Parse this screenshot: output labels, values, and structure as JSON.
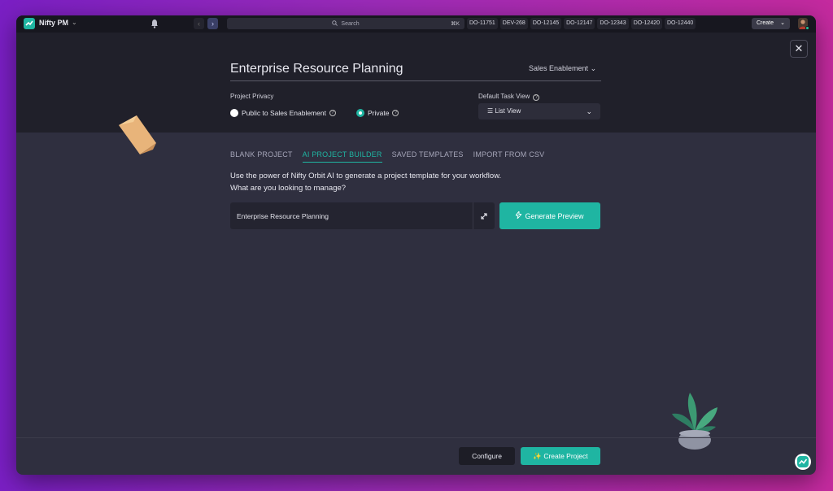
{
  "topbar": {
    "workspace_name": "Nifty PM",
    "search_placeholder": "Search",
    "search_shortcut": "⌘K",
    "tickets": [
      "DO-11751",
      "DEV-268",
      "DO-12145",
      "DO-12147",
      "DO-12343",
      "DO-12420",
      "DO-12440"
    ],
    "create_label": "Create"
  },
  "modal": {
    "project_name": "Enterprise Resource Planning",
    "team": "Sales Enablement",
    "privacy_label": "Project Privacy",
    "privacy_options": [
      "Public to Sales Enablement",
      "Private"
    ],
    "privacy_selected": "Private",
    "view_label": "Default Task View",
    "view_value": "List View",
    "tabs": [
      "BLANK PROJECT",
      "AI PROJECT BUILDER",
      "SAVED TEMPLATES",
      "IMPORT FROM CSV"
    ],
    "active_tab": "AI PROJECT BUILDER",
    "description_line1": "Use the power of Nifty Orbit AI to generate a project template for your workflow.",
    "description_line2": "What are you looking to manage?",
    "prompt_value": "Enterprise Resource Planning",
    "generate_label": "Generate Preview",
    "configure_label": "Configure",
    "create_project_label": "Create Project"
  },
  "colors": {
    "accent": "#1fb5a2",
    "background": "#2f2f3f",
    "header": "#20202a"
  }
}
